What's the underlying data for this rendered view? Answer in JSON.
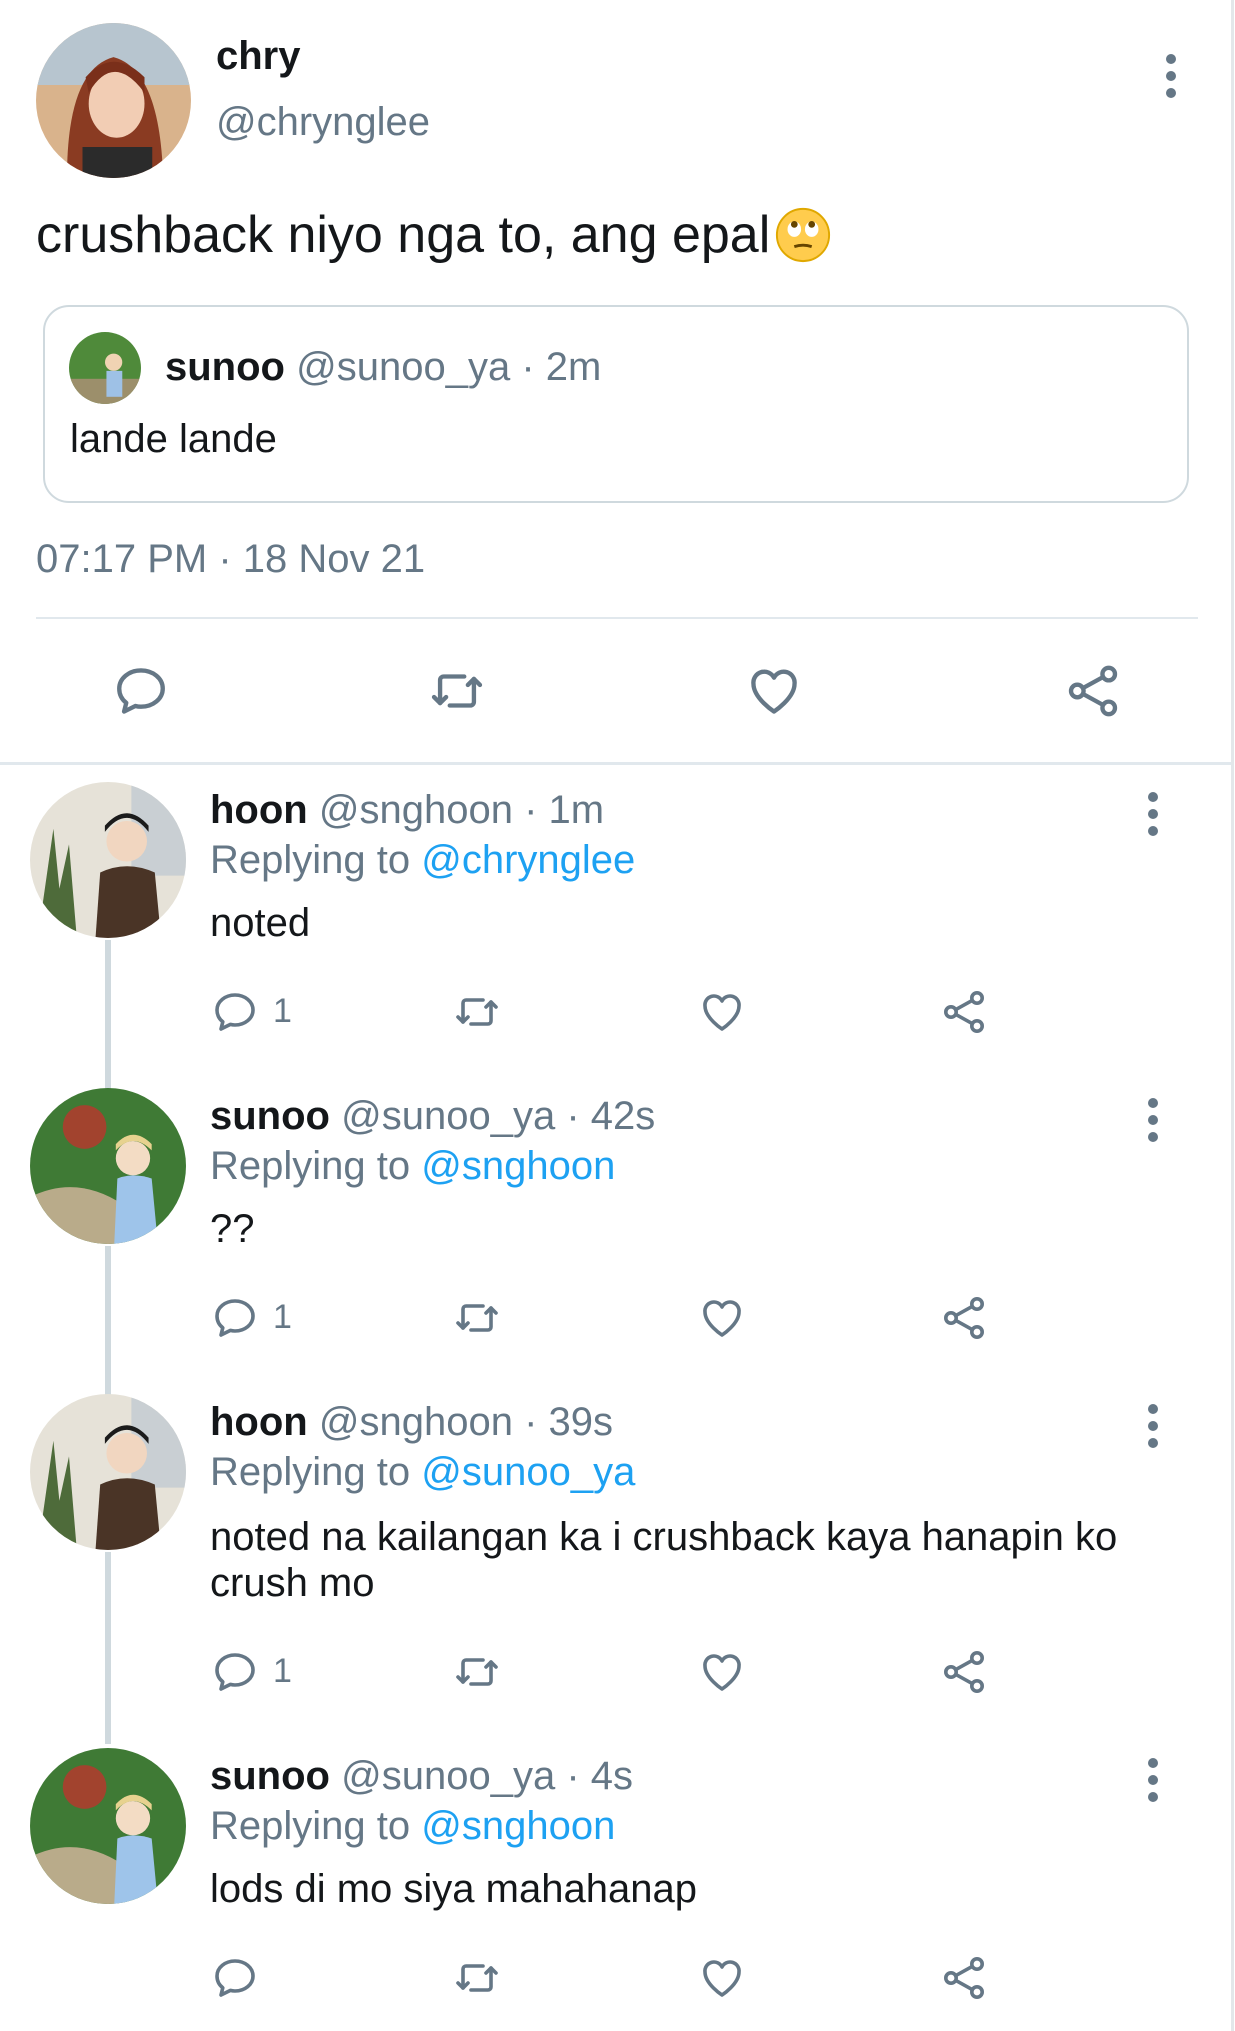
{
  "main_tweet": {
    "author_name": "chry",
    "author_handle": "@chrynglee",
    "text": "crushback niyo nga to, ang epal",
    "emoji_icon": "face-with-rolling-eyes-icon",
    "quoted": {
      "name": "sunoo",
      "handle": "@sunoo_ya",
      "time": "· 2m",
      "text": "lande lande"
    },
    "timestamp": "07:17 PM · 18 Nov 21"
  },
  "replies": [
    {
      "name": "hoon",
      "handle": "@snghoon",
      "time": "· 1m",
      "replying_label": "Replying to",
      "replying_to": "@chrynglee",
      "text": "noted",
      "reply_count": "1"
    },
    {
      "name": "sunoo",
      "handle": "@sunoo_ya",
      "time": "· 42s",
      "replying_label": "Replying to",
      "replying_to": "@snghoon",
      "text": "??",
      "reply_count": "1"
    },
    {
      "name": "hoon",
      "handle": "@snghoon",
      "time": "· 39s",
      "replying_label": "Replying to",
      "replying_to": "@sunoo_ya",
      "text": "noted na kailangan ka i crushback kaya hanapin ko crush mo",
      "reply_count": "1"
    },
    {
      "name": "sunoo",
      "handle": "@sunoo_ya",
      "time": "· 4s",
      "replying_label": "Replying to",
      "replying_to": "@snghoon",
      "text": "lods di mo siya mahahanap",
      "reply_count": ""
    }
  ],
  "colors": {
    "text": "#14171a",
    "muted": "#657786",
    "link": "#1da1f2",
    "border": "#cfd9de"
  }
}
